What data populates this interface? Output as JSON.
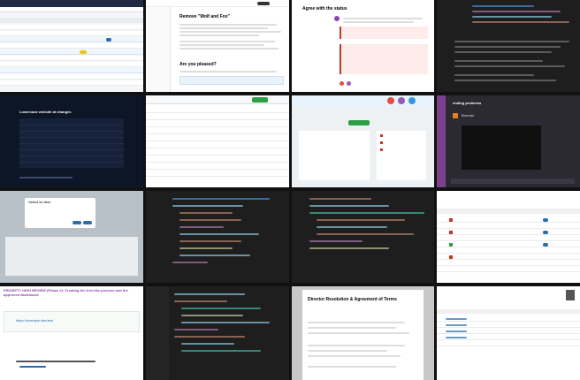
{
  "tiles": {
    "t5": {
      "title": "Lowercase website at changes"
    },
    "t8": {
      "title": "ending problems",
      "status": "Brendal"
    },
    "t9": {
      "dialog_title": "Select an item",
      "cancel": "Cancel",
      "ok": "Save"
    },
    "t10": {
      "caption": "yarn build:gql:app:view!"
    },
    "t13": {
      "heading": "PRIORITY: HIGH REVIEW (Phase 2): Creating the tree-like process and the approved dashboard",
      "link": "https://example.site/test"
    },
    "t15": {
      "heading": "Director Resolution & Agreement of Terms"
    },
    "t2": {
      "heading": "Remove \"Wolf and Fox\"",
      "question": "Are you pleased?"
    },
    "t3": {
      "heading": "Agree with the status"
    }
  },
  "colors": {
    "dark_bg": "#1e1e1e",
    "navy": "#0d1626",
    "blue_accent": "#2b6cb0",
    "green": "#2e9e44",
    "red": "#c0392b",
    "purple": "#8e44ad"
  }
}
